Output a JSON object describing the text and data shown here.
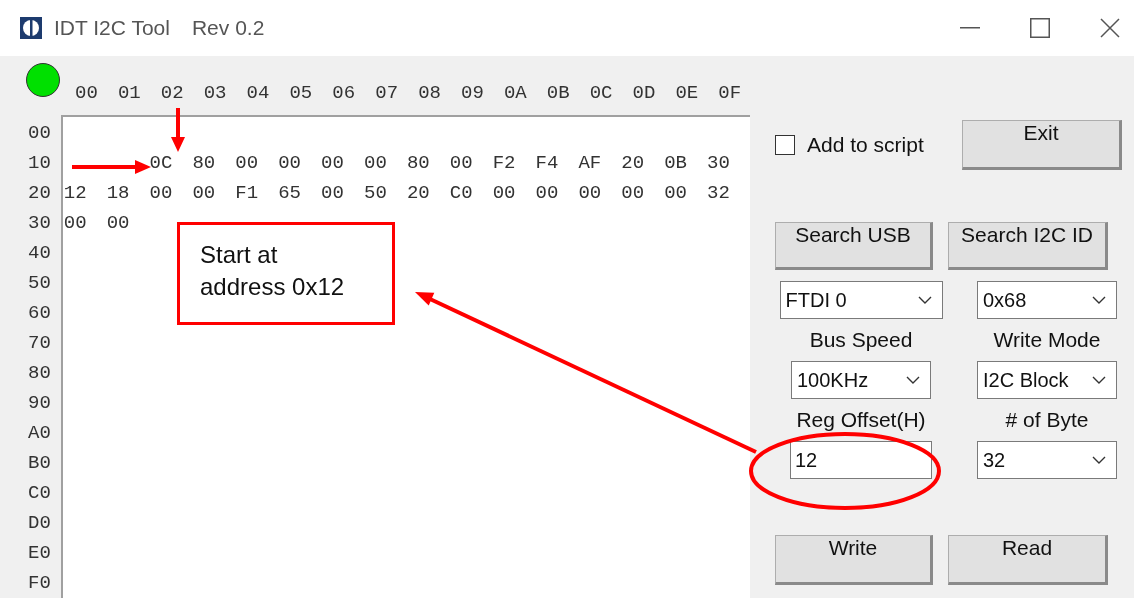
{
  "window": {
    "title": "IDT I2C Tool",
    "version": "Rev 0.2"
  },
  "status": {
    "connected": true
  },
  "hex_view": {
    "column_headers": [
      "00",
      "01",
      "02",
      "03",
      "04",
      "05",
      "06",
      "07",
      "08",
      "09",
      "0A",
      "0B",
      "0C",
      "0D",
      "0E",
      "0F"
    ],
    "rows": [
      {
        "address": "00"
      },
      {
        "address": "10",
        "cells": [
          "0C",
          "80",
          "00",
          "00",
          "00",
          "00",
          "80",
          "00",
          "F2",
          "F4",
          "AF",
          "20",
          "0B",
          "30"
        ]
      },
      {
        "address": "20",
        "cells": [
          "12",
          "18",
          "00",
          "00",
          "F1",
          "65",
          "00",
          "50",
          "20",
          "C0",
          "00",
          "00",
          "00",
          "00",
          "00",
          "32"
        ]
      },
      {
        "address": "30",
        "cells": [
          "00",
          "00"
        ]
      },
      {
        "address": "40"
      },
      {
        "address": "50"
      },
      {
        "address": "60"
      },
      {
        "address": "70"
      },
      {
        "address": "80"
      },
      {
        "address": "90"
      },
      {
        "address": "A0"
      },
      {
        "address": "B0"
      },
      {
        "address": "C0"
      },
      {
        "address": "D0"
      },
      {
        "address": "E0"
      },
      {
        "address": "F0"
      }
    ]
  },
  "controls": {
    "add_to_script": {
      "label": "Add to script",
      "checked": false
    },
    "exit_button": "Exit",
    "search_usb_button": "Search USB",
    "search_i2c_id_button": "Search I2C ID",
    "usb_device": "FTDI 0",
    "i2c_id": "0x68",
    "bus_speed": {
      "label": "Bus Speed",
      "value": "100KHz"
    },
    "write_mode": {
      "label": "Write Mode",
      "value": "I2C Block"
    },
    "reg_offset": {
      "label": "Reg Offset(H)",
      "value": "12"
    },
    "num_bytes": {
      "label": "# of Byte",
      "value": "32"
    },
    "write_button": "Write",
    "read_button": "Read"
  },
  "annotation": {
    "callout": "Start at\naddress 0x12"
  }
}
